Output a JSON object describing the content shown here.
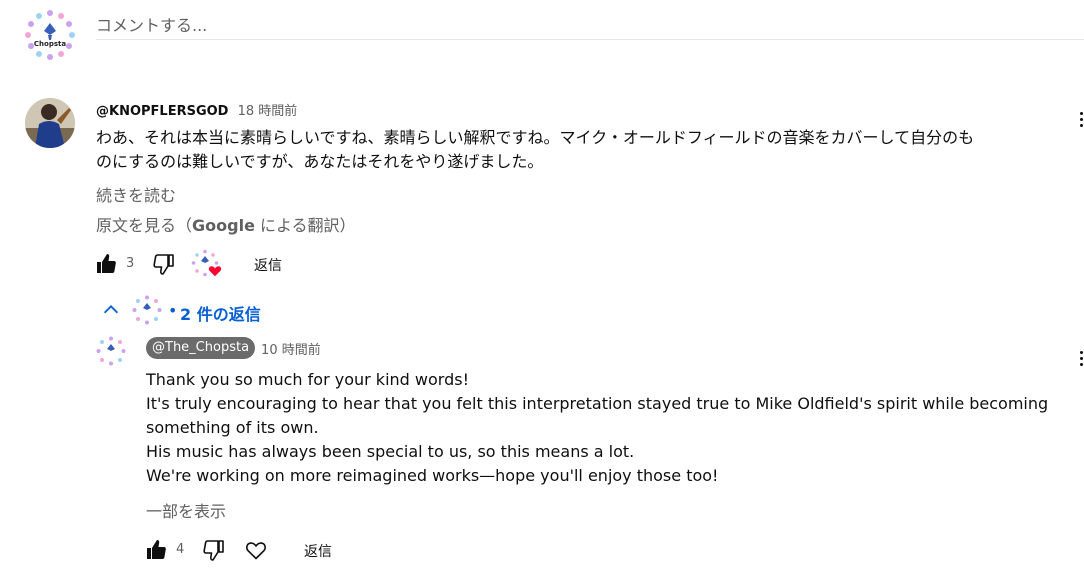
{
  "composer": {
    "placeholder": "コメントする..."
  },
  "comment": {
    "author": "@KNOPFLERSGOD",
    "time": "18 時間前",
    "text_line1": "わあ、それは本当に素晴らしいですね、素晴らしい解釈ですね。マイク・オールドフィールドの音楽をカバーして自分のも",
    "text_line2": "のにするのは難しいですが、あなたはそれをやり遂げました。",
    "read_more": "続きを読む",
    "see_original_prefix": "原文を見る（",
    "see_original_brand": "Google",
    "see_original_suffix": " による翻訳）",
    "like_count": "3",
    "reply_label": "返信"
  },
  "replies_toggle": {
    "dot": "•",
    "label": "2 件の返信"
  },
  "reply": {
    "author": "@The_Chopsta",
    "time": "10 時間前",
    "lines": [
      "Thank you so much for your kind words!",
      "It's truly encouraging to hear that you felt this interpretation stayed true to Mike Oldfield's spirit while becoming",
      "something of its own.",
      "His music has always been special to us, so this means a lot.",
      "We're working on more reimagined works—hope you'll enjoy those too!"
    ],
    "show_less": "一部を表示",
    "like_count": "4",
    "reply_label": "返信"
  },
  "logo": {
    "text": "Chopsta"
  },
  "colors": {
    "link_blue": "#065fd4",
    "author_chip": "#6b6b6b",
    "heart_red": "#ff0033",
    "meta_grey": "#606060"
  },
  "icons": [
    "thumb-up-icon",
    "thumb-down-icon",
    "heart-icon",
    "chevron-up-icon",
    "more-vert-icon"
  ]
}
